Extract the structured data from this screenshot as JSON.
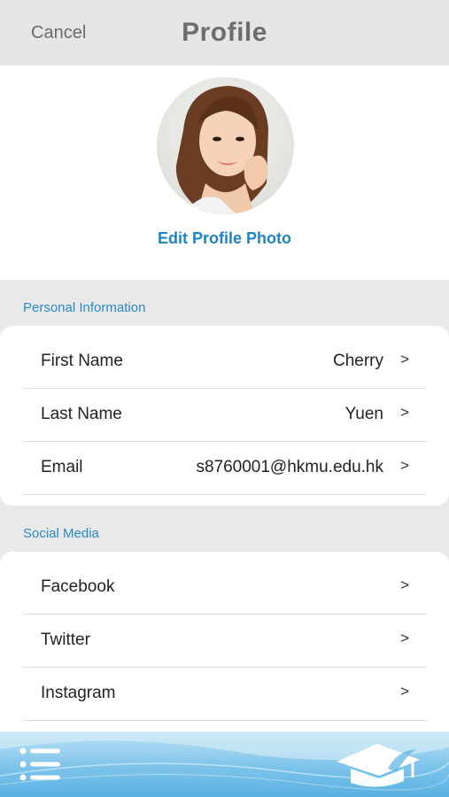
{
  "header": {
    "cancel_label": "Cancel",
    "title": "Profile"
  },
  "photo": {
    "edit_label": "Edit Profile Photo"
  },
  "personal": {
    "section_label": "Personal Information",
    "rows": [
      {
        "label": "First Name",
        "value": "Cherry",
        "chevron": ">"
      },
      {
        "label": "Last Name",
        "value": "Yuen",
        "chevron": ">"
      },
      {
        "label": "Email",
        "value": "s8760001@hkmu.edu.hk",
        "chevron": ">"
      }
    ]
  },
  "social": {
    "section_label": "Social Media",
    "rows": [
      {
        "label": "Facebook",
        "chevron": ">"
      },
      {
        "label": "Twitter",
        "chevron": ">"
      },
      {
        "label": "Instagram",
        "chevron": ">"
      }
    ]
  },
  "footer": {
    "menu_icon": "hamburger-list-icon",
    "logo_icon": "graduation-cap-logo"
  },
  "colors": {
    "accent": "#1e84c8",
    "header_bg": "#e6e6e6",
    "page_bg": "#e9e9e9",
    "footer_blue": "#5ab2e3"
  }
}
